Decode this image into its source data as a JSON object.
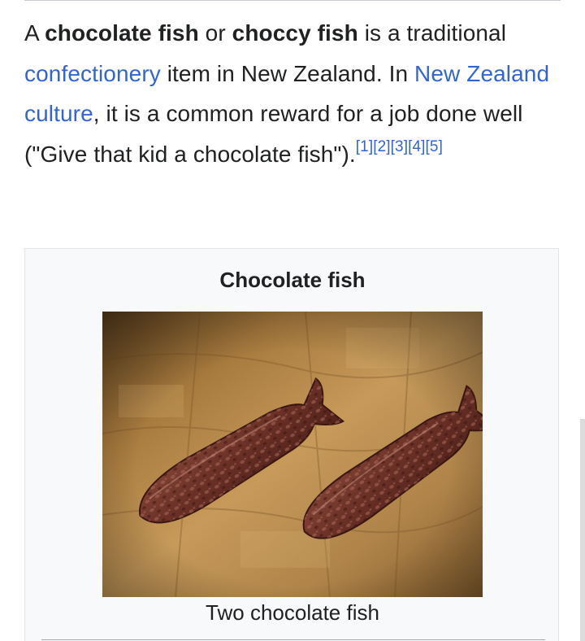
{
  "intro": {
    "t1": "A ",
    "bold1": "chocolate fish",
    "t2": " or ",
    "bold2": "choccy fish",
    "t3": " is a traditional ",
    "link1": "confectionery",
    "t4": " item in New Zealand. In ",
    "link2": "New Zealand culture",
    "t5": ", it is a common reward for a job done well (\"Give that kid a chocolate fish\").",
    "refs": [
      "[1]",
      "[2]",
      "[3]",
      "[4]",
      "[5]"
    ]
  },
  "infobox": {
    "title": "Chocolate fish",
    "image_alt": "Two chocolate fish on a wooden board",
    "caption": "Two chocolate fish"
  },
  "colors": {
    "link": "#3366cc",
    "text": "#202122",
    "infobox_bg": "#f8f9fa",
    "chocolate": "#5a2a22",
    "wood": "#b88a4e"
  }
}
